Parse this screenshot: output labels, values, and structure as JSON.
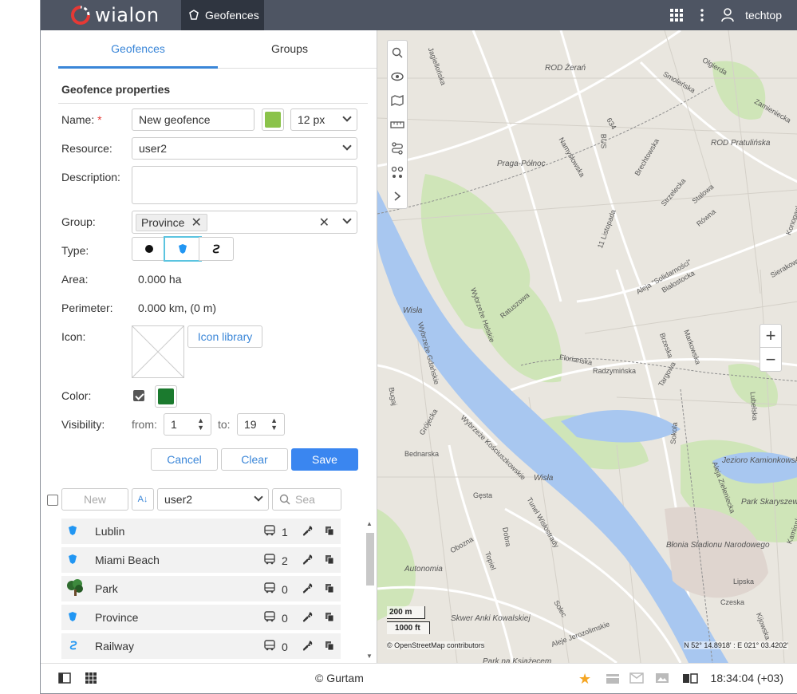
{
  "app": {
    "logo_text": "wialon",
    "active_module": "Geofences",
    "user": "techtop"
  },
  "tabs": [
    {
      "label": "Geofences",
      "active": true
    },
    {
      "label": "Groups",
      "active": false
    }
  ],
  "form": {
    "section_title": "Geofence properties",
    "name_label": "Name:",
    "name_required": "*",
    "name_value": "New geofence",
    "name_color": "#8bc34a",
    "font_size": "12 px",
    "resource_label": "Resource:",
    "resource_value": "user2",
    "description_label": "Description:",
    "description_value": "",
    "group_label": "Group:",
    "group_chip": "Province",
    "type_label": "Type:",
    "area_label": "Area:",
    "area_value": "0.000 ha",
    "perimeter_label": "Perimeter:",
    "perimeter_value": "0.000 km, (0 m)",
    "icon_label": "Icon:",
    "icon_library": "Icon library",
    "color_label": "Color:",
    "color_value": "#1b7a2e",
    "visibility_label": "Visibility:",
    "from_label": "from:",
    "from_value": "1",
    "to_label": "to:",
    "to_value": "19",
    "cancel": "Cancel",
    "clear": "Clear",
    "save": "Save"
  },
  "list_toolbar": {
    "new_label": "New",
    "resource": "user2",
    "search_placeholder": "Sea"
  },
  "geofences": [
    {
      "name": "Lublin",
      "icon": "polygon-icon",
      "count": "1"
    },
    {
      "name": "Miami Beach",
      "icon": "polygon-icon",
      "count": "2"
    },
    {
      "name": "Park",
      "icon": "tree-icon",
      "count": "0"
    },
    {
      "name": "Province",
      "icon": "polygon-icon",
      "count": "0"
    },
    {
      "name": "Railway",
      "icon": "line-icon",
      "count": "0"
    }
  ],
  "map": {
    "labels": [
      "ROD Żerań",
      "Praga-Północ",
      "ROD Pratulińska",
      "Jezioro Kamionkowskie",
      "Park Skaryszewski",
      "Błonia Stadionu Narodowego",
      "Autonomia",
      "Skwer Anki Kowalskiej",
      "Park na Książęcem",
      "Wisła",
      "Wisła"
    ],
    "streets": [
      "Jagiellońska",
      "Namysłowska",
      "11 Listopada",
      "Aleja \"Solidarności\"",
      "Ratuszowa",
      "Targowa",
      "Wybrzeże Helskie",
      "Wybrzeże Gdańskie",
      "Wybrzeże Kościuszkowskie",
      "Tunel Wisłostrady",
      "Dobra",
      "Topiel",
      "Solec",
      "Aleje Jerozolimskie",
      "Sokola",
      "Aleja Zieleniecka",
      "Lubelska",
      "Bugaj",
      "Grójecka",
      "Florianska",
      "Czeska",
      "Lipska",
      "Kijowska",
      "Stalowa",
      "Białostocka",
      "Brzeska",
      "Markowska",
      "Radzymińska",
      "Smoleńska",
      "Olgierda",
      "Brechtowska",
      "Strzelecka",
      "Równa",
      "Sierakowska",
      "Konopacka",
      "Bednarska",
      "Obozna",
      "Gęsta",
      "Kamionkowska",
      "634",
      "BUS",
      "Zamieniecka"
    ],
    "scale_m": "200 m",
    "scale_ft": "1000 ft",
    "attribution": "© OpenStreetMap contributors",
    "coords": "N 52° 14.8918' : E 021° 03.4202'"
  },
  "footer": {
    "copyright": "© Gurtam",
    "time": "18:34:04 (+03)"
  },
  "colors": {
    "accent": "#3a86d8",
    "topbar": "#4e5563",
    "polygon": "#2196f3"
  }
}
